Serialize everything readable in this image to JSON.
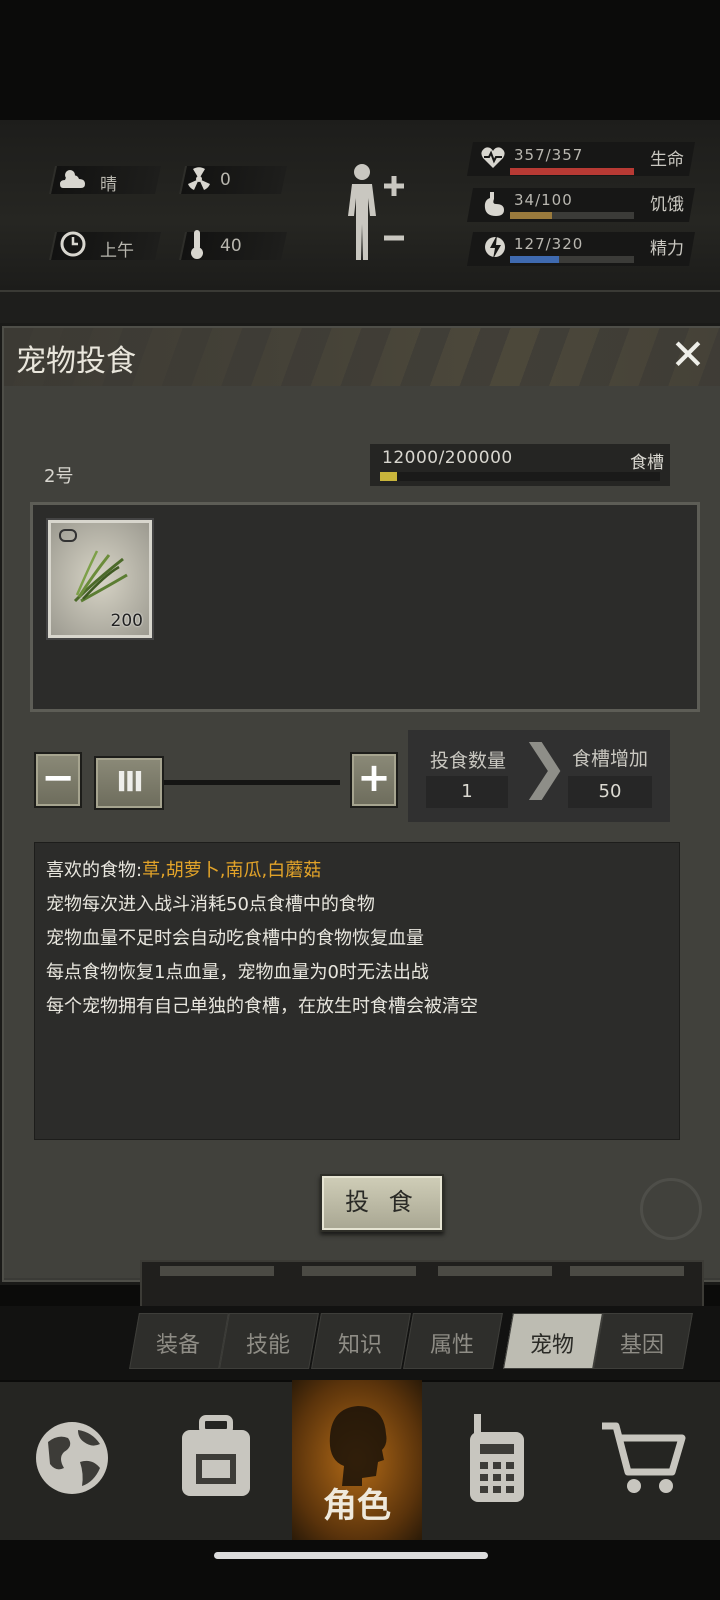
{
  "status": {
    "weather": {
      "icon": "cloud-sun-icon",
      "label": "晴"
    },
    "radiation": {
      "icon": "radiation-icon",
      "value": "0"
    },
    "time": {
      "icon": "clock-icon",
      "label": "上午"
    },
    "temperature": {
      "icon": "thermometer-icon",
      "value": "40"
    },
    "health": {
      "icon": "heart-icon",
      "value": "357/357",
      "label": "生命",
      "fraction": 1.0,
      "color": "#b83a34"
    },
    "hunger": {
      "icon": "stomach-icon",
      "value": "34/100",
      "label": "饥饿",
      "fraction": 0.34,
      "color": "#9a7a3c"
    },
    "energy": {
      "icon": "bolt-icon",
      "value": "127/320",
      "label": "精力",
      "fraction": 0.397,
      "color": "#3f6ab0"
    }
  },
  "modal": {
    "title": "宠物投食",
    "close_icon": "close-icon",
    "pet_no": "2号",
    "trough": {
      "value": "12000/200000",
      "label": "食槽",
      "fraction": 0.06
    },
    "item": {
      "icon": "grass-icon",
      "count": "200"
    },
    "feed_amount_label": "投食数量",
    "feed_amount": "1",
    "trough_increase_label": "食槽增加",
    "trough_increase": "50",
    "slider_fraction": 0.0,
    "desc": {
      "liked_prefix": "喜欢的食物:",
      "liked_foods": "草,胡萝卜,南瓜,白蘑菇",
      "line2": "宠物每次进入战斗消耗50点食槽中的食物",
      "line3": "宠物血量不足时会自动吃食槽中的食物恢复血量",
      "line4": "每点食物恢复1点血量，宠物血量为0时无法出战",
      "line5": "每个宠物拥有自己单独的食槽，在放生时食槽会被清空"
    },
    "feed_button": "投 食"
  },
  "tabs": [
    {
      "label": "装备",
      "active": false
    },
    {
      "label": "技能",
      "active": false
    },
    {
      "label": "知识",
      "active": false
    },
    {
      "label": "属性",
      "active": false
    },
    {
      "label": "宠物",
      "active": true
    },
    {
      "label": "基因",
      "active": false
    }
  ],
  "nav": {
    "world_icon": "globe-icon",
    "bag_icon": "backpack-icon",
    "character_label": "角色",
    "radio_icon": "walkie-talkie-icon",
    "shop_icon": "cart-icon"
  }
}
